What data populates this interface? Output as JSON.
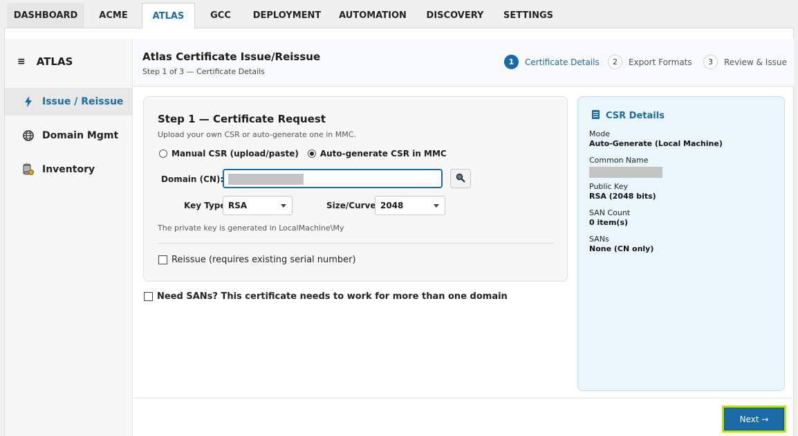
{
  "tabs": [
    {
      "label": "DASHBOARD",
      "active": false
    },
    {
      "label": "ACME",
      "active": false
    },
    {
      "label": "ATLAS",
      "active": true
    },
    {
      "label": "GCC",
      "active": false
    },
    {
      "label": "DEPLOYMENT",
      "active": false
    },
    {
      "label": "AUTOMATION",
      "active": false
    },
    {
      "label": "DISCOVERY",
      "active": false
    },
    {
      "label": "SETTINGS",
      "active": false
    }
  ],
  "sidebar": {
    "menu_icon": "hamburger-icon",
    "title": "ATLAS",
    "items": [
      {
        "label": "Issue / Reissue",
        "icon": "bolt-icon",
        "active": true
      },
      {
        "label": "Domain Mgmt",
        "icon": "globe-icon",
        "active": false
      },
      {
        "label": "Inventory",
        "icon": "database-icon",
        "active": false
      }
    ]
  },
  "header": {
    "title": "Atlas Certificate Issue/Reissue",
    "subtitle": "Step 1 of 3 — Certificate Details",
    "steps": [
      {
        "num": "1",
        "label": "Certificate Details",
        "active": true
      },
      {
        "num": "2",
        "label": "Export Formats",
        "active": false
      },
      {
        "num": "3",
        "label": "Review & Issue",
        "active": false
      }
    ]
  },
  "form": {
    "title": "Step 1 — Certificate Request",
    "description": "Upload your own CSR or auto-generate one in MMC.",
    "radio_manual": "Manual CSR (upload/paste)",
    "radio_auto": "Auto-generate CSR in MMC",
    "selected_mode": "auto",
    "domain_label": "Domain (CN):",
    "domain_value": "",
    "lookup_icon": "magnifier-icon",
    "key_type_label": "Key Type:",
    "key_type_value": "RSA",
    "size_label": "Size/Curve:",
    "size_value": "2048",
    "hint": "The private key is generated in LocalMachine\\My",
    "reissue_label": "Reissue (requires existing serial number)",
    "reissue_checked": false
  },
  "sans": {
    "label": "Need SANs? This certificate needs to work for more than one domain",
    "checked": false
  },
  "csr_panel": {
    "title": "CSR Details",
    "icon": "document-icon",
    "mode_label": "Mode",
    "mode_value": "Auto-Generate (Local Machine)",
    "cn_label": "Common Name",
    "cn_value": "",
    "pubkey_label": "Public Key",
    "pubkey_value": "RSA (2048 bits)",
    "sancount_label": "SAN Count",
    "sancount_value": "0 item(s)",
    "sans_label": "SANs",
    "sans_value": "None (CN only)"
  },
  "footer": {
    "next_label": "Next →"
  },
  "colors": {
    "accent": "#1a6aa6",
    "highlight": "#b7e01d",
    "panel": "#eaf5fc"
  }
}
